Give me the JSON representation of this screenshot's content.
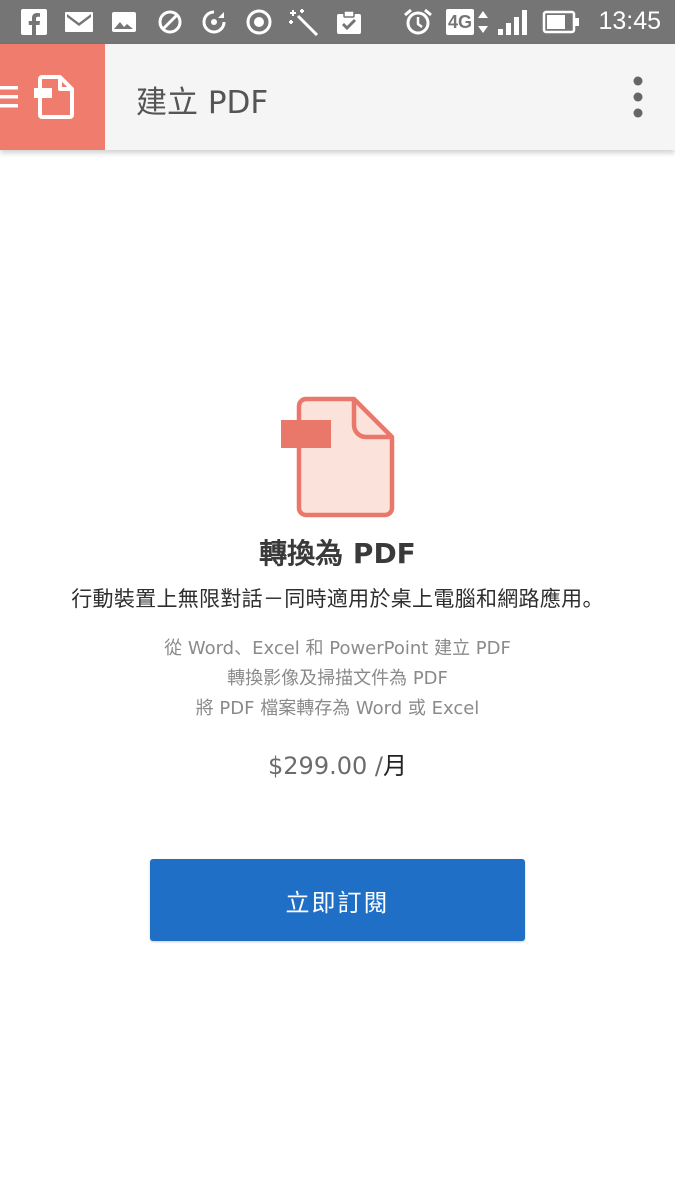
{
  "status_bar": {
    "time": "13:45",
    "network": "4G",
    "icons": [
      "facebook-icon",
      "gmail-icon",
      "gallery-icon",
      "blocked-icon",
      "sync-icon",
      "record-icon",
      "magic-wand-icon",
      "clipboard-check-icon",
      "alarm-icon",
      "network-4g-icon",
      "signal-icon",
      "battery-icon"
    ]
  },
  "app_bar": {
    "title": "建立 PDF",
    "nav_icon": "menu-icon",
    "app_icon": "create-pdf-icon",
    "overflow_icon": "more-vert-icon"
  },
  "main": {
    "heading": "轉換為 PDF",
    "subheading": "行動裝置上無限對話－同時適用於桌上電腦和網路應用。",
    "features": [
      "從 Word、Excel 和 PowerPoint 建立 PDF",
      "轉換影像及掃描文件為 PDF",
      "將 PDF 檔案轉存為 Word 或 Excel"
    ],
    "price": "$299.00 /",
    "price_period": "月",
    "subscribe_label": "立即訂閱"
  },
  "colors": {
    "accent": "#ef7c6c",
    "button": "#1f6fc7",
    "status_bar": "#757575",
    "app_bar": "#f5f5f5"
  }
}
